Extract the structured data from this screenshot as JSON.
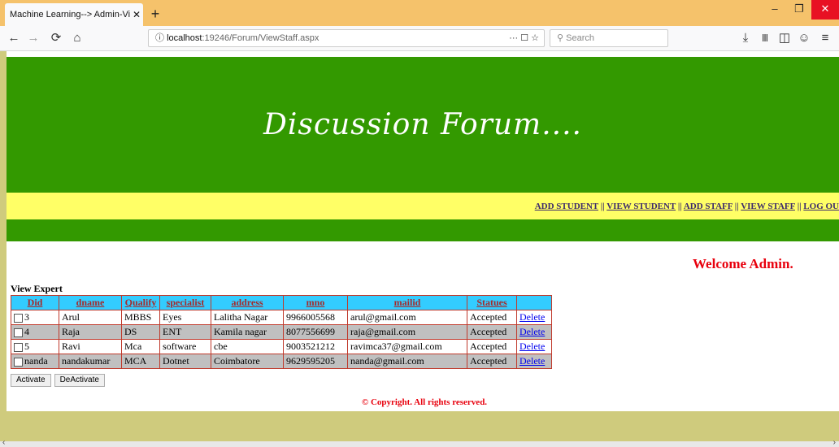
{
  "browser": {
    "tab_title": "Machine Learning--> Admin-Viewl",
    "tab_close": "✕",
    "new_tab": "+",
    "window_buttons": [
      "–",
      "❐",
      "✕"
    ],
    "url_host": "localhost",
    "url_path": ":19246/Forum/ViewStaff.aspx",
    "url_info_icon": "ⓘ",
    "url_actions": "··· ☐ ☆",
    "search_placeholder": "Search",
    "icons": {
      "back": "←",
      "forward": "→",
      "reload": "⟳",
      "home": "⌂",
      "download": "⤓",
      "library": "Ⅲ",
      "sidebar": "◫",
      "account": "☺",
      "menu": "≡"
    }
  },
  "page": {
    "header_title": "Discussion Forum....",
    "menu": [
      "ADD STUDENT",
      "VIEW STUDENT",
      "ADD STAFF",
      "VIEW STAFF",
      "LOG OU"
    ],
    "menu_separator": " || ",
    "welcome": "Welcome Admin.",
    "section_title": "View Expert",
    "table": {
      "headers": [
        "Did",
        "dname",
        "Qualify",
        "specialist",
        "address",
        "mno",
        "mailid",
        "Statues",
        ""
      ],
      "rows": [
        {
          "did": "3",
          "dname": "Arul",
          "qualify": "MBBS",
          "specialist": "Eyes",
          "address": "Lalitha Nagar",
          "mno": "9966005568",
          "mailid": "arul@gmail.com",
          "status": "Accepted",
          "action": "Delete"
        },
        {
          "did": "4",
          "dname": "Raja",
          "qualify": "DS",
          "specialist": "ENT",
          "address": "Kamila nagar",
          "mno": "8077556699",
          "mailid": "raja@gmail.com",
          "status": "Accepted",
          "action": "Delete"
        },
        {
          "did": "5",
          "dname": "Ravi",
          "qualify": "Mca",
          "specialist": "software",
          "address": "cbe",
          "mno": "9003521212",
          "mailid": "ravimca37@gmail.com",
          "status": "Accepted",
          "action": "Delete"
        },
        {
          "did": "nanda",
          "dname": "nandakumar",
          "qualify": "MCA",
          "specialist": "Dotnet",
          "address": "Coimbatore",
          "mno": "9629595205",
          "mailid": "nanda@gmail.com",
          "status": "Accepted",
          "action": "Delete"
        }
      ]
    },
    "buttons": {
      "activate": "Activate",
      "deactivate": "DeActivate"
    },
    "copyright": "© Copyright. All rights reserved."
  },
  "colors": {
    "header_green": "#339900",
    "menu_yellow": "#ffff66",
    "table_header": "#33ccff",
    "accent_red": "#e8000d",
    "tabbar": "#f5c26b"
  }
}
